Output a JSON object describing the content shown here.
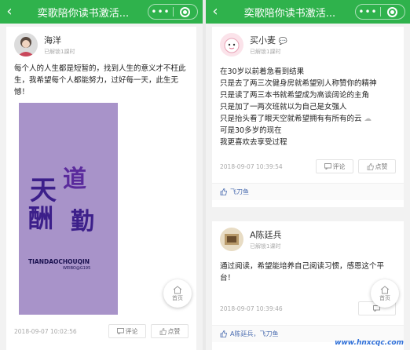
{
  "left": {
    "topbar": {
      "back_icon": "back-chevron-icon",
      "title": "奕歌陪你读书激活...",
      "menu_label": "•••"
    },
    "post": {
      "username": "海洋",
      "read_status": "已解锁1課时",
      "text": "每个人的人生都是短暂的，找到人生的意义才不枉此生，我希望每个人都能努力，过好每一天，此生无憾！",
      "poster": {
        "line1a": "天",
        "line1b": "道",
        "line2a": "酬",
        "line2b": "勤",
        "caption": "TIANDAOCHOUQIN",
        "caption2": "WEIBO@G195"
      },
      "time": "2018-09-07 10:02:56",
      "comment_label": "评论",
      "like_label": "点赞"
    },
    "home_label": "首页"
  },
  "right": {
    "topbar": {
      "back_icon": "back-chevron-icon",
      "title": "奕歌陪你读书激活...",
      "menu_label": "•••"
    },
    "post1": {
      "username": "买小麦",
      "read_status": "已解锁1課时",
      "lines": [
        "在30岁以前着急看到结果",
        "只是去了两三次健身房就希望别人称赞你的精神",
        "只是读了两三本书就希望成为高谈阔论的主角",
        "只是加了一两次班就以为自己是女强人",
        "只是抬头看了眼天空就希望拥有有所有的云",
        "可是30多岁的现在",
        "我更喜欢去享受过程"
      ],
      "time": "2018-09-07 10:39:54",
      "comment_label": "评论",
      "like_label": "点赞",
      "likers": "飞刀鱼"
    },
    "post2": {
      "username": "A陈廷兵",
      "read_status": "已解锁1课时",
      "text": "通过阅读，希望能培养自己阅读习惯，感恩这个平台！",
      "time": "2018-09-07 10:39:46",
      "likers": "A陈廷兵，飞刀鱼"
    },
    "home_label": "首页",
    "watermark": "www.hnxcqc.com"
  }
}
